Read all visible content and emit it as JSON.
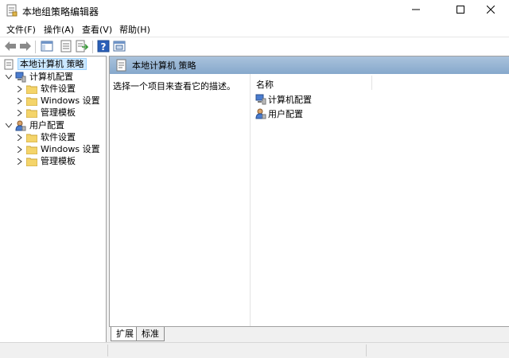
{
  "window": {
    "title": "本地组策略编辑器",
    "controls": [
      "minimize-icon",
      "maximize-icon",
      "close-icon"
    ]
  },
  "menu": {
    "file": "文件(F)",
    "action": "操作(A)",
    "view": "查看(V)",
    "help": "帮助(H)"
  },
  "toolbar": {
    "icons": [
      "back-arrow-icon",
      "forward-arrow-icon",
      "show-hide-tree-icon",
      "properties-icon",
      "export-list-icon",
      "help-icon",
      "console-icon"
    ]
  },
  "tree": {
    "root": "本地计算机 策略",
    "computer_config": "计算机配置",
    "computer_children": [
      "软件设置",
      "Windows 设置",
      "管理模板"
    ],
    "user_config": "用户配置",
    "user_children": [
      "软件设置",
      "Windows 设置",
      "管理模板"
    ]
  },
  "content": {
    "header_title": "本地计算机 策略",
    "description": "选择一个项目来查看它的描述。",
    "column_name": "名称",
    "items": [
      "计算机配置",
      "用户配置"
    ]
  },
  "tabs": {
    "extended": "扩展",
    "standard": "标准"
  },
  "colors": {
    "header_gradient_top": "#aac3dc",
    "header_gradient_bottom": "#86a8cc",
    "selection": "#cce8ff",
    "folder": "#f4d46a"
  }
}
